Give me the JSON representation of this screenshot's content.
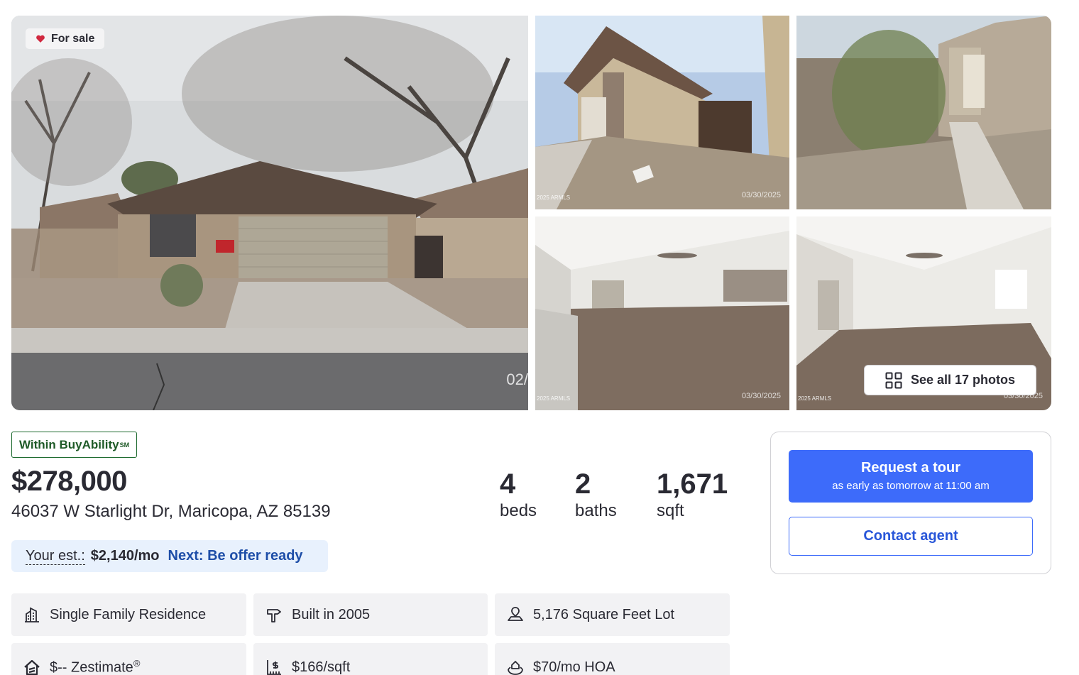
{
  "gallery": {
    "badge_label": "For sale",
    "main_photo_stamp": "02/",
    "photo_stamp": "03/30/2025",
    "watermark": "2025 ARMLS",
    "see_all_label": "See all 17 photos"
  },
  "summary": {
    "buyability_label": "Within BuyAbility",
    "buyability_mark": "SM",
    "price": "$278,000",
    "address": "46037 W Starlight Dr, Maricopa, AZ 85139",
    "stats": [
      {
        "value": "4",
        "label": "beds"
      },
      {
        "value": "2",
        "label": "baths"
      },
      {
        "value": "1,671",
        "label": "sqft"
      }
    ],
    "estimate": {
      "label": "Your est.:",
      "value": "$2,140/mo",
      "next_link": "Next: Be offer ready"
    }
  },
  "facts": [
    {
      "icon": "building-icon",
      "text": "Single Family Residence"
    },
    {
      "icon": "hammer-icon",
      "text": "Built in 2005"
    },
    {
      "icon": "lot-icon",
      "text": "5,176 Square Feet Lot"
    },
    {
      "icon": "zestimate-icon",
      "text": "$-- Zestimate",
      "mark": "®"
    },
    {
      "icon": "price-per-sqft-icon",
      "text": "$166/sqft"
    },
    {
      "icon": "hoa-icon",
      "text": "$70/mo HOA"
    }
  ],
  "contact": {
    "tour_title": "Request a tour",
    "tour_subtitle": "as early as tomorrow at 11:00 am",
    "contact_label": "Contact agent"
  },
  "colors": {
    "primary": "#3d6bfa",
    "buyability_green": "#1e5a27",
    "estimate_bg": "#e8f1fd",
    "fact_bg": "#f2f2f4",
    "sale_heart": "#d1283f"
  }
}
